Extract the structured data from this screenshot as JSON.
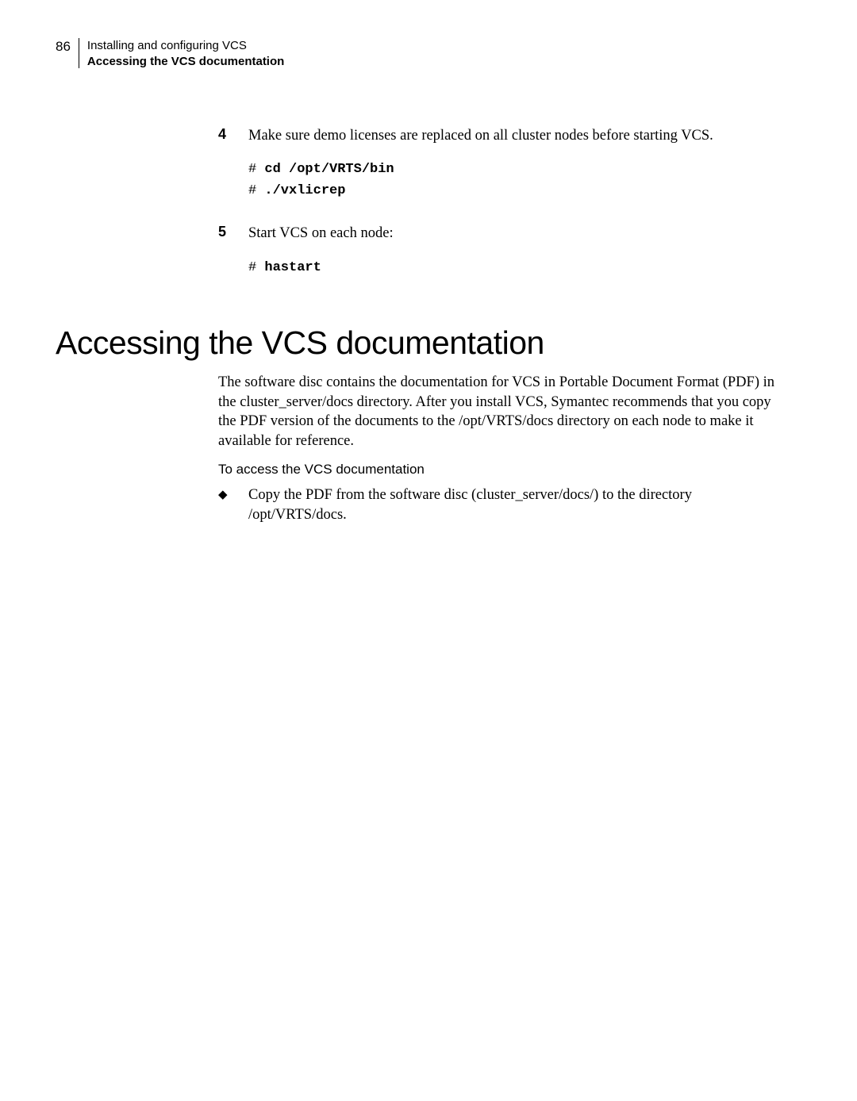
{
  "page": {
    "number": "86",
    "header_main": "Installing and configuring VCS",
    "header_sub": "Accessing the VCS documentation"
  },
  "steps": {
    "s4": {
      "num": "4",
      "text": "Make sure demo licenses are replaced on all cluster nodes before starting VCS.",
      "code": [
        {
          "prompt": "# ",
          "cmd": "cd /opt/VRTS/bin"
        },
        {
          "prompt": "# ",
          "cmd": "./vxlicrep"
        }
      ]
    },
    "s5": {
      "num": "5",
      "text": "Start VCS on each node:",
      "code": [
        {
          "prompt": "# ",
          "cmd": "hastart"
        }
      ]
    }
  },
  "section": {
    "heading": "Accessing the VCS documentation",
    "para": "The software disc contains the documentation for VCS in Portable Document Format (PDF) in the cluster_server/docs directory. After you install VCS, Symantec recommends that you copy the PDF version of the documents to the /opt/VRTS/docs directory on each node to make it available for reference.",
    "subheading": "To access the VCS documentation",
    "bullet": "Copy the PDF from the software disc (cluster_server/docs/) to the directory /opt/VRTS/docs."
  }
}
